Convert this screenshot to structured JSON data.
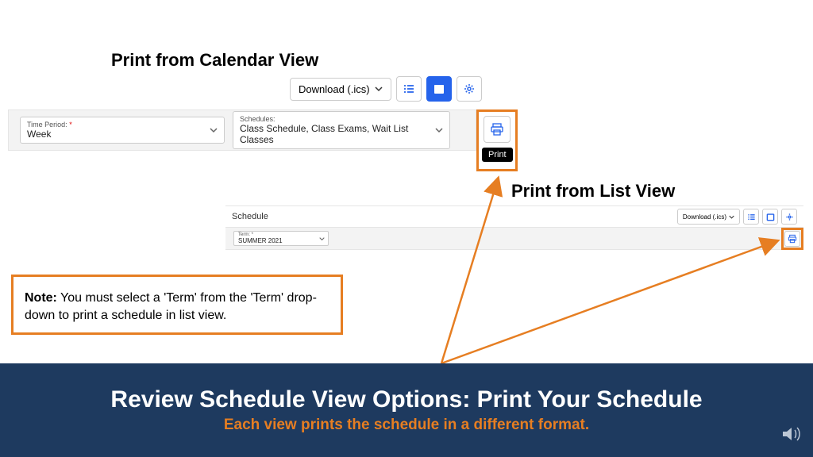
{
  "headers": {
    "h1": "Print from Calendar View",
    "h2": "Print from List View"
  },
  "section1": {
    "download_label": "Download (.ics)",
    "time_period": {
      "label": "Time Period:",
      "value": "Week"
    },
    "schedules": {
      "label": "Schedules:",
      "value": "Class Schedule, Class Exams, Wait List Classes"
    },
    "tooltip": "Print"
  },
  "section2": {
    "panel_title": "Schedule",
    "download_label": "Download (.ics)",
    "term": {
      "label": "Term: *",
      "value": "SUMMER 2021"
    }
  },
  "note": {
    "prefix": "Note:",
    "text": " You must select a 'Term' from the 'Term' drop-down to print a schedule in list view."
  },
  "footer": {
    "title": "Review Schedule View Options: Print Your Schedule",
    "subtitle": "Each view prints the schedule in a different format."
  }
}
